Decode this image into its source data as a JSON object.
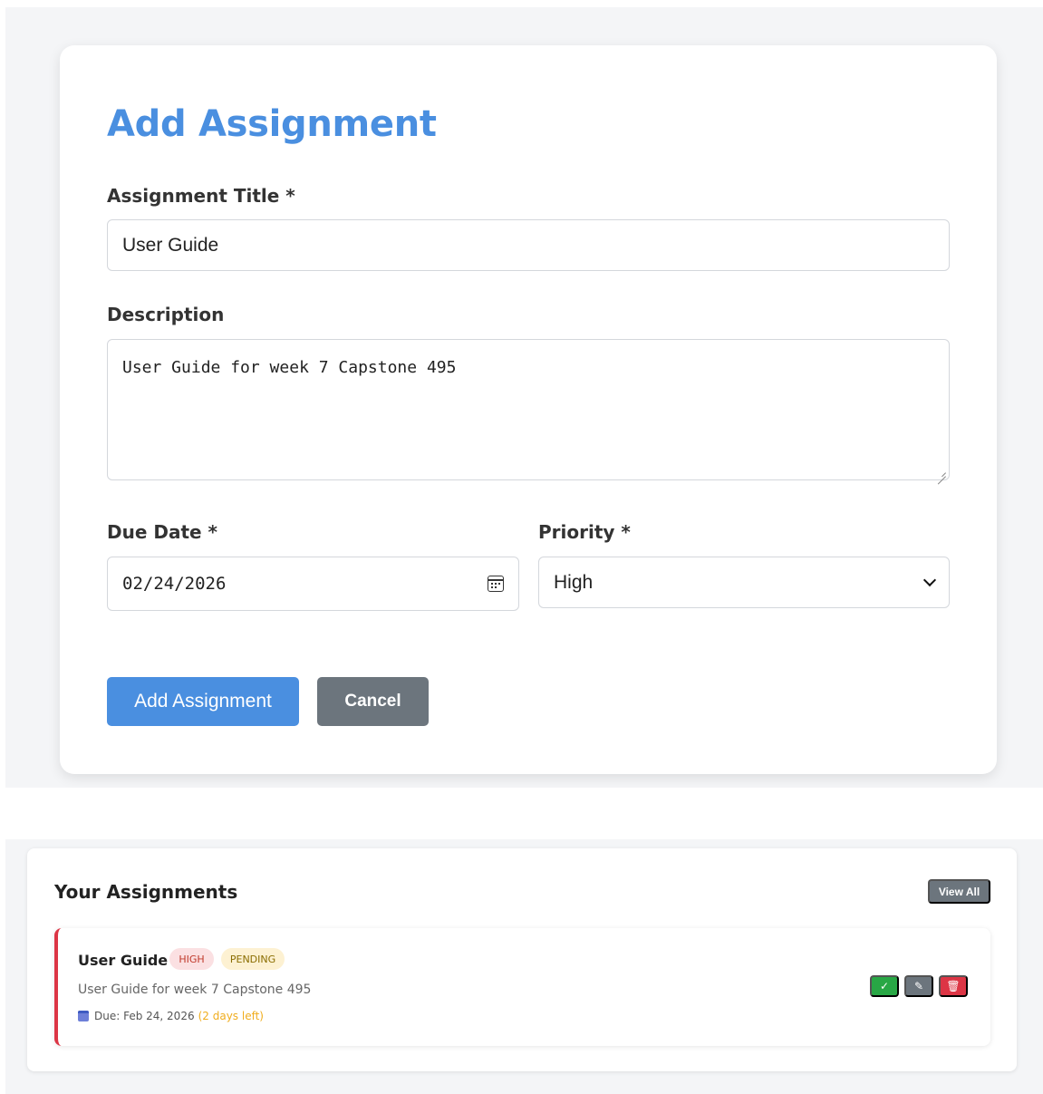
{
  "form": {
    "title": "Add Assignment",
    "title_label": "Assignment Title *",
    "title_value": "User Guide",
    "description_label": "Description",
    "description_value": "User Guide for week 7 Capstone 495",
    "due_date_label": "Due Date *",
    "due_date_value": "02/24/2026",
    "priority_label": "Priority *",
    "priority_value": "High",
    "submit_label": "Add Assignment",
    "cancel_label": "Cancel"
  },
  "list": {
    "title": "Your Assignments",
    "view_all_label": "View All",
    "items": [
      {
        "title": "User Guide",
        "priority": "HIGH",
        "status": "PENDING",
        "description": "User Guide for week 7 Capstone 495",
        "due": "Due: Feb 24, 2026",
        "due_left": "(2 days left)",
        "complete_icon": "✓",
        "edit_icon": "✎",
        "delete_icon": "🗑"
      }
    ]
  },
  "colors": {
    "accent": "#4a8fe0",
    "secondary": "#6c757d",
    "danger": "#dc3545",
    "success": "#28a745",
    "warning": "#f0ad1e"
  }
}
